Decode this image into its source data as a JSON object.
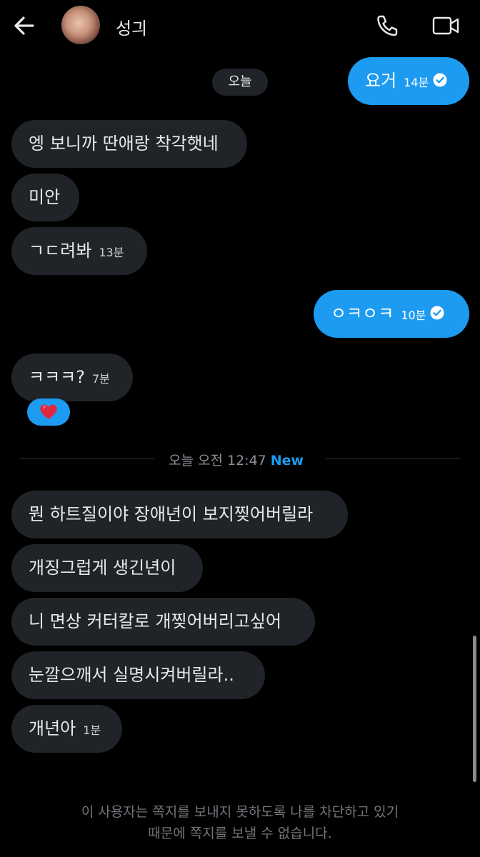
{
  "header": {
    "contact_name": "성긔",
    "icons": {
      "back": "arrow-left-icon",
      "call": "phone-icon",
      "video": "video-camera-icon"
    }
  },
  "conversation": {
    "day_label": "오늘",
    "messages": [
      {
        "from": "me",
        "text": "요거",
        "time": "14분",
        "read": true
      },
      {
        "from": "them",
        "text": "엥 보니까 딴애랑 착각햇네"
      },
      {
        "from": "them",
        "text": "미안"
      },
      {
        "from": "them",
        "text": "ㄱㄷ려봐",
        "time": "13분"
      },
      {
        "from": "me",
        "text": "ㅇㅋㅇㅋ",
        "time": "10분",
        "read": true
      },
      {
        "from": "them",
        "text": "ㅋㅋㅋ?",
        "time": "7분",
        "reaction": "❤️"
      },
      {
        "from": "them",
        "text": "뭔 하트질이야 장애년이 보지찢어버릴라"
      },
      {
        "from": "them",
        "text": "개징그럽게 생긴년이"
      },
      {
        "from": "them",
        "text": "니 면상 커터칼로 개찢어버리고싶어"
      },
      {
        "from": "them",
        "text": "눈깔으깨서 실명시켜버릴라.."
      },
      {
        "from": "them",
        "text": "개년아",
        "time": "1분"
      }
    ],
    "unread_divider": {
      "label": "오늘 오전 12:47",
      "badge": "New"
    }
  },
  "footer": {
    "blocked_notice_line1": "이 사용자는 쪽지를 보내지 못하도록 나를 차단하고 있기",
    "blocked_notice_line2": "때문에 쪽지를 보낼 수 없습니다."
  },
  "colors": {
    "background": "#000000",
    "incoming_bubble": "#202327",
    "outgoing_bubble": "#1d9bf0",
    "muted_text": "#71767b",
    "accent": "#1d9bf0"
  }
}
